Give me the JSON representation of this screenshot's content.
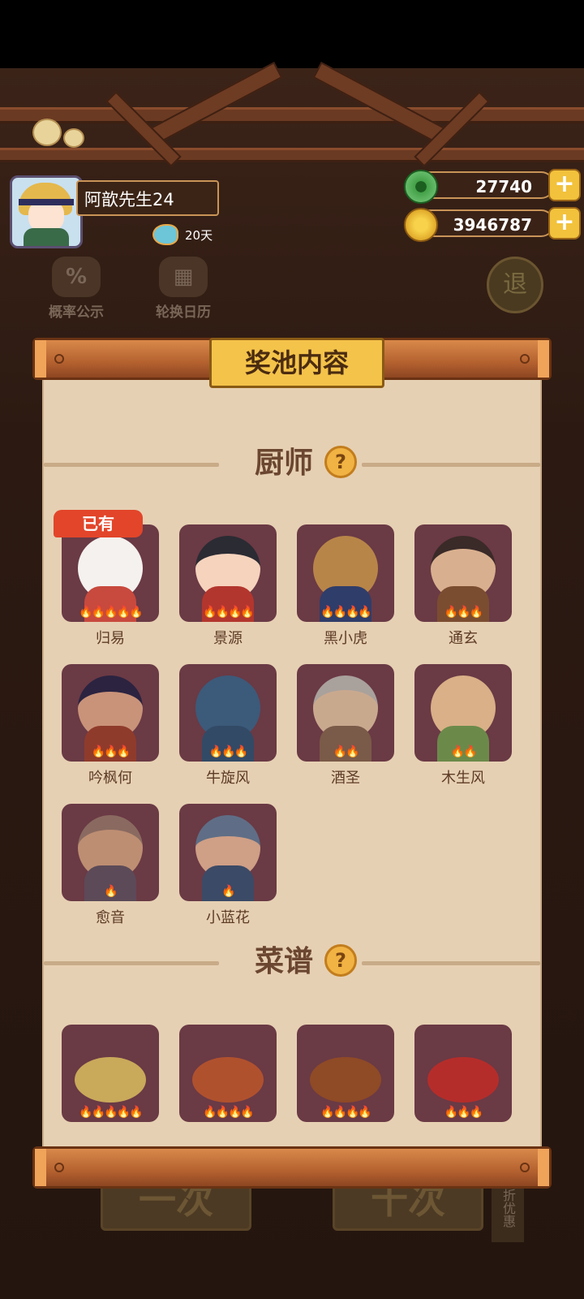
{
  "player": {
    "name": "阿歆先生24",
    "days": "20天"
  },
  "currency": {
    "jade": "27740",
    "coins": "3946787"
  },
  "background_menu": {
    "probability_label": "概率公示",
    "probability_icon": "%",
    "calendar_label": "轮换日历",
    "back_icon": "退",
    "single_draw": "一次",
    "ten_draw": "十次",
    "discount": "九折优惠"
  },
  "panel": {
    "title": "奖池内容",
    "chefs_section": "厨师",
    "recipes_section": "菜谱",
    "help_icon": "?",
    "owned_tag": "已有",
    "chefs": [
      {
        "name": "归易",
        "stars": "🔥🔥🔥🔥🔥"
      },
      {
        "name": "景源",
        "stars": "🔥🔥🔥🔥"
      },
      {
        "name": "黑小虎",
        "stars": "🔥🔥🔥🔥"
      },
      {
        "name": "通玄",
        "stars": "🔥🔥🔥"
      },
      {
        "name": "吟枫何",
        "stars": "🔥🔥🔥"
      },
      {
        "name": "牛旋风",
        "stars": "🔥🔥🔥"
      },
      {
        "name": "酒圣",
        "stars": "🔥🔥"
      },
      {
        "name": "木生风",
        "stars": "🔥🔥"
      },
      {
        "name": "愈音",
        "stars": "🔥"
      },
      {
        "name": "小蓝花",
        "stars": "🔥"
      }
    ],
    "recipes": [
      {
        "stars": "🔥🔥🔥🔥🔥"
      },
      {
        "stars": "🔥🔥🔥🔥"
      },
      {
        "stars": "🔥🔥🔥🔥"
      },
      {
        "stars": "🔥🔥🔥"
      }
    ]
  }
}
